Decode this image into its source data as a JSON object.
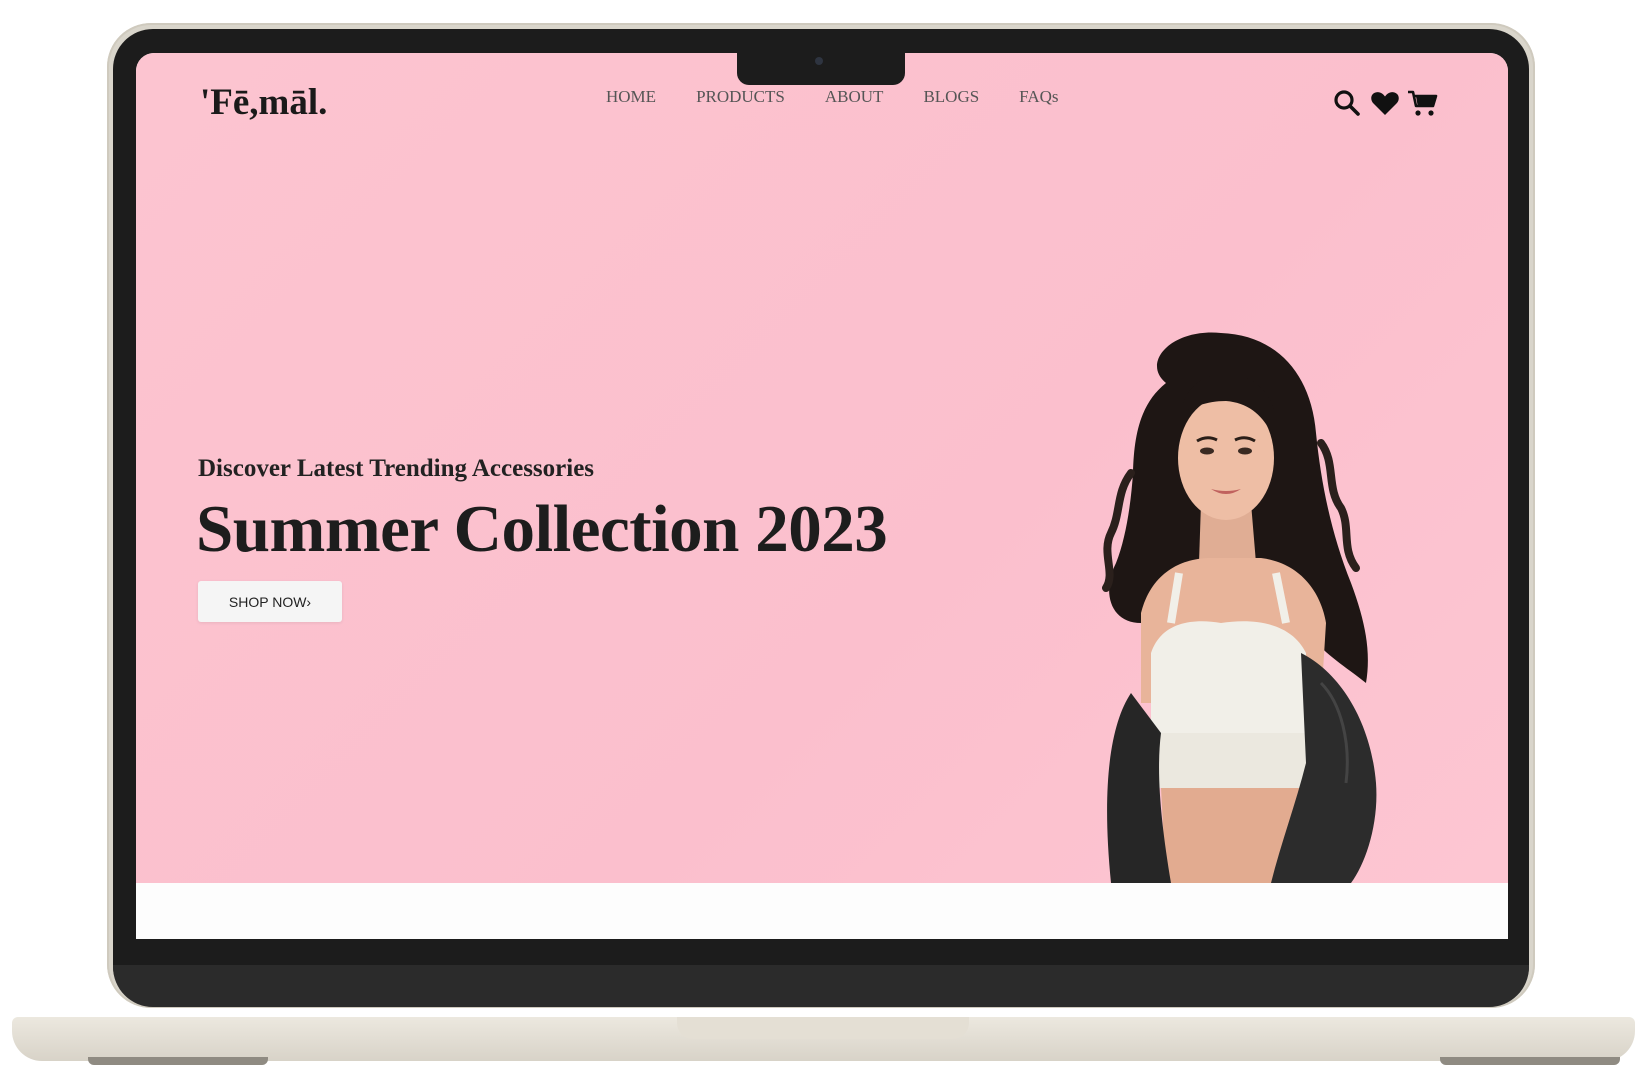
{
  "site": {
    "logo": "'Fē,māl.",
    "nav": [
      "HOME",
      "PRODUCTS",
      "ABOUT",
      "BLOGS",
      "FAQs"
    ],
    "icons": [
      "search-icon",
      "heart-icon",
      "cart-icon"
    ]
  },
  "hero": {
    "subtitle": "Discover Latest Trending Accessories",
    "title": "Summer Collection 2023",
    "cta": "SHOP NOW",
    "cta_arrow": "›"
  },
  "colors": {
    "hero_bg": "#fbc1ce",
    "text": "#1d1d1d",
    "button_bg": "#f5f5f5",
    "device_frame": "#d9d5cb"
  }
}
